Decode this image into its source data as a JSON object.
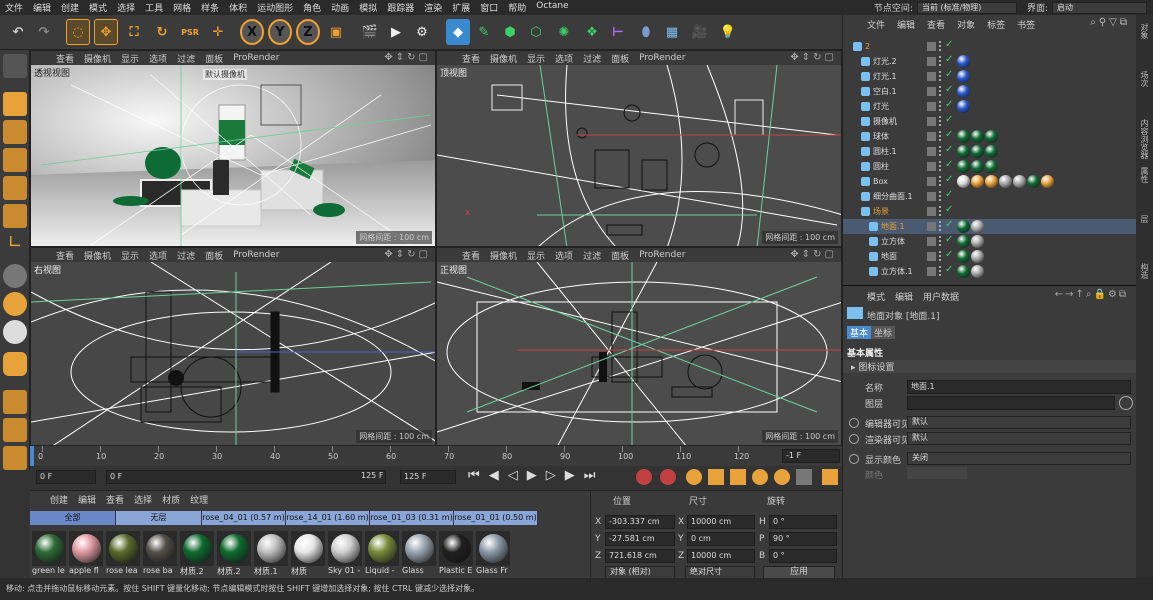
{
  "menubar": {
    "items": [
      "文件",
      "编辑",
      "创建",
      "模式",
      "选择",
      "工具",
      "网格",
      "样条",
      "体积",
      "运动图形",
      "角色",
      "动画",
      "模拟",
      "跟踪器",
      "渲染",
      "扩展",
      "窗口",
      "帮助",
      "Octane"
    ],
    "node_space_label": "节点空间:",
    "node_space_value": "当前 (标准/物理)",
    "layout_label": "界面:",
    "layout_value": "启动"
  },
  "viewports": {
    "menu": [
      "查看",
      "摄像机",
      "显示",
      "选项",
      "过滤",
      "面板",
      "ProRender"
    ],
    "perspective": {
      "title": "透视视图",
      "camera_label": "默认摄像机",
      "grid": "网格间距 : 100 cm"
    },
    "top": {
      "title": "顶视图",
      "grid": "网格间距 : 100 cm"
    },
    "right": {
      "title": "右视图",
      "grid": "网格间距 : 100 cm"
    },
    "front": {
      "title": "正视图",
      "grid": "网格间距 : 100 cm"
    }
  },
  "timeline": {
    "ticks": [
      "0",
      "10",
      "20",
      "30",
      "40",
      "50",
      "60",
      "70",
      "80",
      "90",
      "100",
      "110",
      "120"
    ],
    "end_field": "-1 F",
    "start_frame": "0 F",
    "min_frame": "0 F",
    "max_frame": "125 F",
    "end_frame": "125 F"
  },
  "materials": {
    "menu": [
      "创建",
      "编辑",
      "查看",
      "选择",
      "材质",
      "纹理"
    ],
    "tabs": [
      "全部",
      "无层",
      "rose_04_01 (0.57 m)",
      "rose_14_01 (1.60 m)",
      "rose_01_03 (0.31 m)",
      "rose_01_01 (0.50 m)"
    ],
    "items": [
      {
        "label": "green le",
        "color": "#2e6b35"
      },
      {
        "label": "apple fl",
        "color": "#e09aa3"
      },
      {
        "label": "rose lea",
        "color": "#5a6b2a"
      },
      {
        "label": "rose ba",
        "color": "#55504a"
      },
      {
        "label": "材质.2",
        "color": "#0f6b2f"
      },
      {
        "label": "材质.2",
        "color": "#0f6b2f"
      },
      {
        "label": "材质.1",
        "color": "#bfbfbf"
      },
      {
        "label": "材质",
        "color": "#e8e8e8"
      },
      {
        "label": "Sky 01 -",
        "color": "#d0d0d0"
      },
      {
        "label": "Liquid -",
        "color": "#7a8a3a"
      },
      {
        "label": "Glass",
        "color": "#9aa6b0"
      },
      {
        "label": "Plastic E",
        "color": "#202020"
      },
      {
        "label": "Glass Fr",
        "color": "#8b9aa8"
      }
    ]
  },
  "coords": {
    "headers": [
      "位置",
      "尺寸",
      "旋转"
    ],
    "rows": [
      {
        "axis": "X",
        "pos": "-303.337 cm",
        "size_axis": "X",
        "size": "10000 cm",
        "rot_axis": "H",
        "rot": "0 °"
      },
      {
        "axis": "Y",
        "pos": "-27.581 cm",
        "size_axis": "Y",
        "size": "0 cm",
        "rot_axis": "P",
        "rot": "90 °"
      },
      {
        "axis": "Z",
        "pos": "721.618 cm",
        "size_axis": "Z",
        "size": "10000 cm",
        "rot_axis": "B",
        "rot": "0 °"
      }
    ],
    "mode": "对象 (相对)",
    "size_mode": "绝对尺寸",
    "apply": "应用"
  },
  "object_manager": {
    "menu": [
      "文件",
      "编辑",
      "查看",
      "对象",
      "标签",
      "书签"
    ],
    "objects": [
      {
        "name": "2",
        "indent": 0,
        "color": "#e8a23a"
      },
      {
        "name": "灯光.2",
        "indent": 1,
        "color": "#dddddd"
      },
      {
        "name": "灯光.1",
        "indent": 1,
        "color": "#dddddd"
      },
      {
        "name": "空白.1",
        "indent": 1,
        "color": "#dddddd"
      },
      {
        "name": "灯光",
        "indent": 1,
        "color": "#dddddd"
      },
      {
        "name": "摄像机",
        "indent": 1,
        "color": "#dddddd"
      },
      {
        "name": "球体",
        "indent": 1,
        "color": "#dddddd"
      },
      {
        "name": "圆柱.1",
        "indent": 1,
        "color": "#dddddd"
      },
      {
        "name": "圆柱",
        "indent": 1,
        "color": "#dddddd"
      },
      {
        "name": "Box",
        "indent": 1,
        "color": "#dddddd"
      },
      {
        "name": "细分曲面.1",
        "indent": 1,
        "color": "#dddddd"
      },
      {
        "name": "场景",
        "indent": 1,
        "color": "#e8a23a"
      },
      {
        "name": "地面.1",
        "indent": 2,
        "color": "#e8a23a"
      },
      {
        "name": "立方体",
        "indent": 2,
        "color": "#dddddd"
      },
      {
        "name": "地面",
        "indent": 2,
        "color": "#dddddd"
      },
      {
        "name": "立方体.1",
        "indent": 2,
        "color": "#dddddd"
      }
    ]
  },
  "attributes": {
    "menu": [
      "模式",
      "编辑",
      "用户数据"
    ],
    "object_title": "地面对象 [地面.1]",
    "tabs": [
      "基本",
      "坐标"
    ],
    "section": "基本属性",
    "subsection": "图标设置",
    "name_label": "名称",
    "name_value": "地面.1",
    "layer_label": "图层",
    "editor_visible_label": "编辑器可见",
    "editor_visible_value": "默认",
    "render_visible_label": "渲染器可见",
    "render_visible_value": "默认",
    "display_color_label": "显示颜色",
    "display_color_value": "关闭",
    "color_label": "颜色"
  },
  "right_strip": [
    "对象",
    "场次",
    "内容浏览器",
    "属性",
    "层",
    "构造"
  ],
  "statusbar": "移动: 点击并拖动鼠标移动元素。按住 SHIFT 键量化移动; 节点编辑模式时按住 SHIFT 键增加选择对象; 按住 CTRL 键减少选择对象。"
}
